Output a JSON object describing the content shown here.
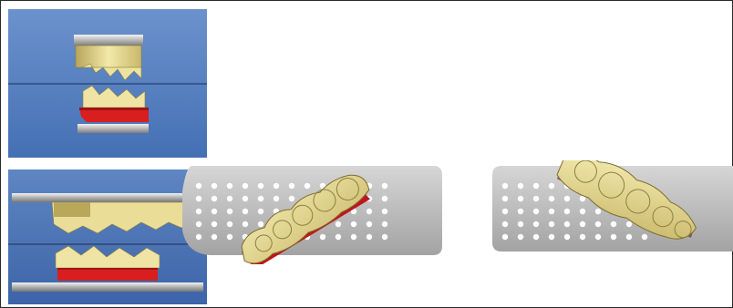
{
  "screen": {
    "views": [
      {
        "id": "articulator-view-top",
        "content": "articulator-model"
      },
      {
        "id": "articulator-view-bottom",
        "content": "articulator-model-zoom"
      }
    ],
    "trays": [
      {
        "id": "scan-tray-upper",
        "hole_rows": 5,
        "hole_cols": 13
      },
      {
        "id": "scan-tray-lower",
        "hole_rows": 5,
        "hole_cols": 10
      }
    ]
  },
  "colors": {
    "viewport_bg_top": "#5f86c2",
    "viewport_bg_bottom": "#3c64a8",
    "plaster_light": "#f1e7a2",
    "plaster_shadow": "#b9a85a",
    "gum_red": "#d81e1e",
    "metal_light": "#e8e8e8",
    "metal_dark": "#8a8a8a",
    "tray_light": "#dcdcdc",
    "tray_dark": "#a9a9a9"
  },
  "icons": [
    "articulator-icon",
    "dental-arch-icon",
    "scan-tray-icon"
  ]
}
